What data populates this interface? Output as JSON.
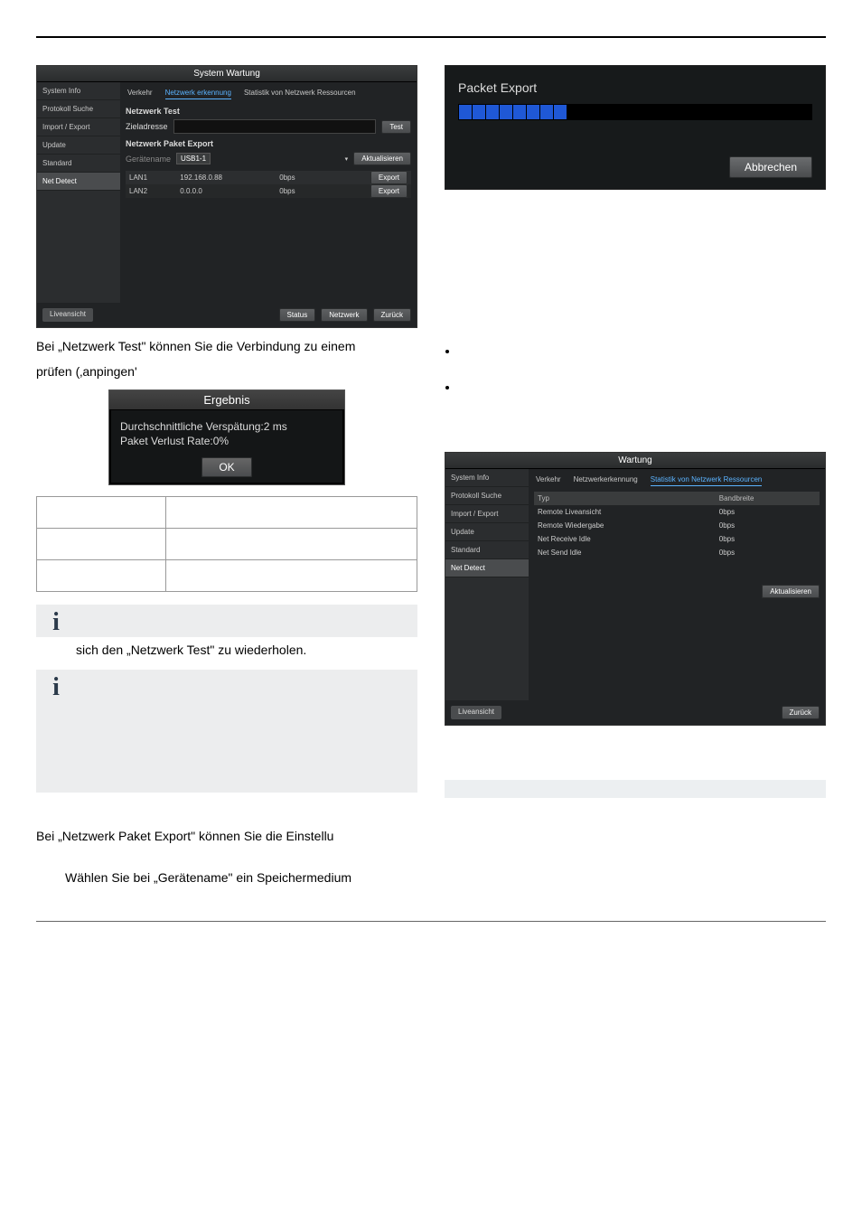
{
  "shot1": {
    "title": "System Wartung",
    "sidebar": [
      "System Info",
      "Protokoll Suche",
      "Import / Export",
      "Update",
      "Standard",
      "Net Detect"
    ],
    "sidebar_active": 5,
    "tabs": [
      "Verkehr",
      "Netzwerk erkennung",
      "Statistik von Netzwerk Ressourcen"
    ],
    "tab_active": 1,
    "section1": "Netzwerk Test",
    "zieladresse_label": "Zieladresse",
    "test_btn": "Test",
    "section2": "Netzwerk Paket Export",
    "geraetename_label": "Gerätename",
    "device_value": "USB1-1",
    "aktualisieren_btn": "Aktualisieren",
    "rows": [
      {
        "if": "LAN1",
        "ip": "192.168.0.88",
        "bps": "0bps",
        "btn": "Export"
      },
      {
        "if": "LAN2",
        "ip": "0.0.0.0",
        "bps": "0bps",
        "btn": "Export"
      }
    ],
    "footer": {
      "live": "Liveansicht",
      "status": "Status",
      "netzwerk": "Netzwerk",
      "zurueck": "Zurück"
    }
  },
  "dlg_packet": {
    "title": "Packet Export",
    "progress_segments": 8,
    "cancel": "Abbrechen"
  },
  "body1": "Bei „Netzwerk Test\" können Sie die Verbindung zu einem",
  "body2": "prüfen (‚anpingen'",
  "dlg_result": {
    "title": "Ergebnis",
    "line1": "Durchschnittliche Verspätung:2 ms",
    "line2": "Paket Verlust Rate:0%",
    "ok": "OK"
  },
  "info1_tail": "sich den „Netzwerk Test\" zu wiederholen.",
  "body3": "Bei „Netzwerk Paket Export\" können Sie die Einstellu",
  "body4": "Wählen Sie bei „Gerätename\" ein Speichermedium",
  "shot3": {
    "title": "Wartung",
    "sidebar": [
      "System Info",
      "Protokoll Suche",
      "Import / Export",
      "Update",
      "Standard",
      "Net Detect"
    ],
    "sidebar_active": 5,
    "tabs": [
      "Verkehr",
      "Netzwerkerkennung",
      "Statistik von Netzwerk Ressourcen"
    ],
    "tab_active": 2,
    "cols": [
      "Typ",
      "Bandbreite"
    ],
    "rows": [
      {
        "t": "Remote Liveansicht",
        "b": "0bps"
      },
      {
        "t": "Remote Wiedergabe",
        "b": "0bps"
      },
      {
        "t": "Net Receive Idle",
        "b": "0bps"
      },
      {
        "t": "Net Send Idle",
        "b": "0bps"
      }
    ],
    "aktual": "Aktualisieren",
    "footer": {
      "live": "Liveansicht",
      "zurueck": "Zurück"
    }
  }
}
